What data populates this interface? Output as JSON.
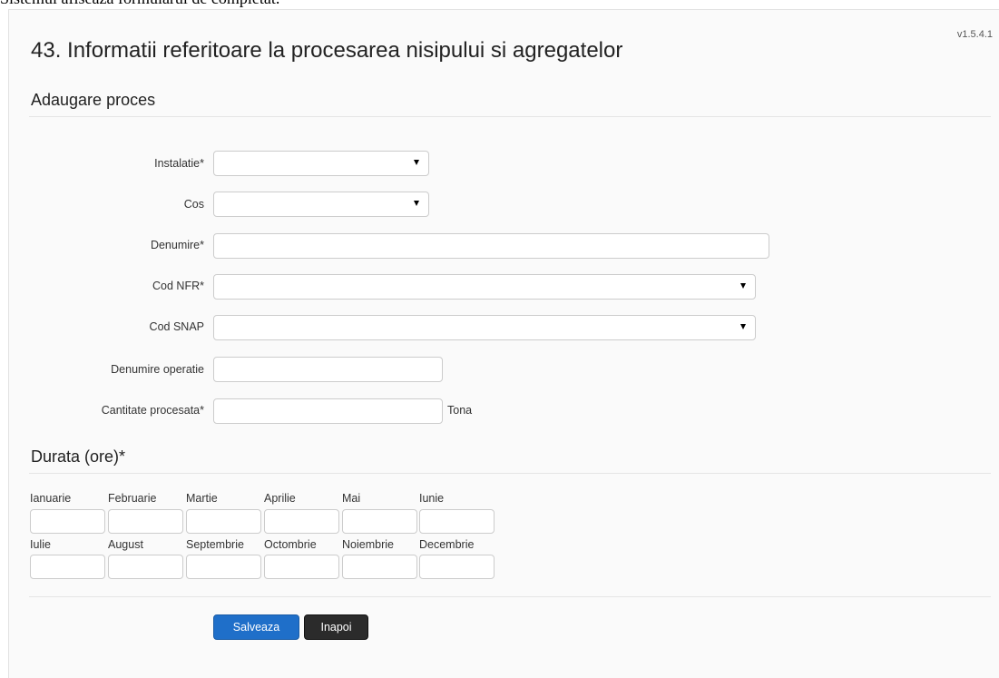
{
  "top_note": "Sistemul afiseaza formularul de completat.",
  "version": "v1.5.4.1",
  "page_title": "43. Informatii referitoare la procesarea nisipului si agregatelor",
  "section_add": "Adaugare proces",
  "fields": {
    "instalatie": {
      "label": "Instalatie*",
      "value": ""
    },
    "cos": {
      "label": "Cos",
      "value": ""
    },
    "denumire": {
      "label": "Denumire*",
      "value": ""
    },
    "cod_nfr": {
      "label": "Cod NFR*",
      "value": ""
    },
    "cod_snap": {
      "label": "Cod SNAP",
      "value": ""
    },
    "denumire_operatie": {
      "label": "Denumire operatie",
      "value": ""
    },
    "cantitate_procesata": {
      "label": "Cantitate procesata*",
      "value": "",
      "unit": "Tona"
    }
  },
  "section_duration": "Durata (ore)*",
  "months": [
    "Ianuarie",
    "Februarie",
    "Martie",
    "Aprilie",
    "Mai",
    "Iunie",
    "Iulie",
    "August",
    "Septembrie",
    "Octombrie",
    "Noiembrie",
    "Decembrie"
  ],
  "buttons": {
    "save": "Salveaza",
    "back": "Inapoi"
  },
  "colors": {
    "save_button": "#1f6fc9",
    "back_button": "#2b2b2b"
  }
}
